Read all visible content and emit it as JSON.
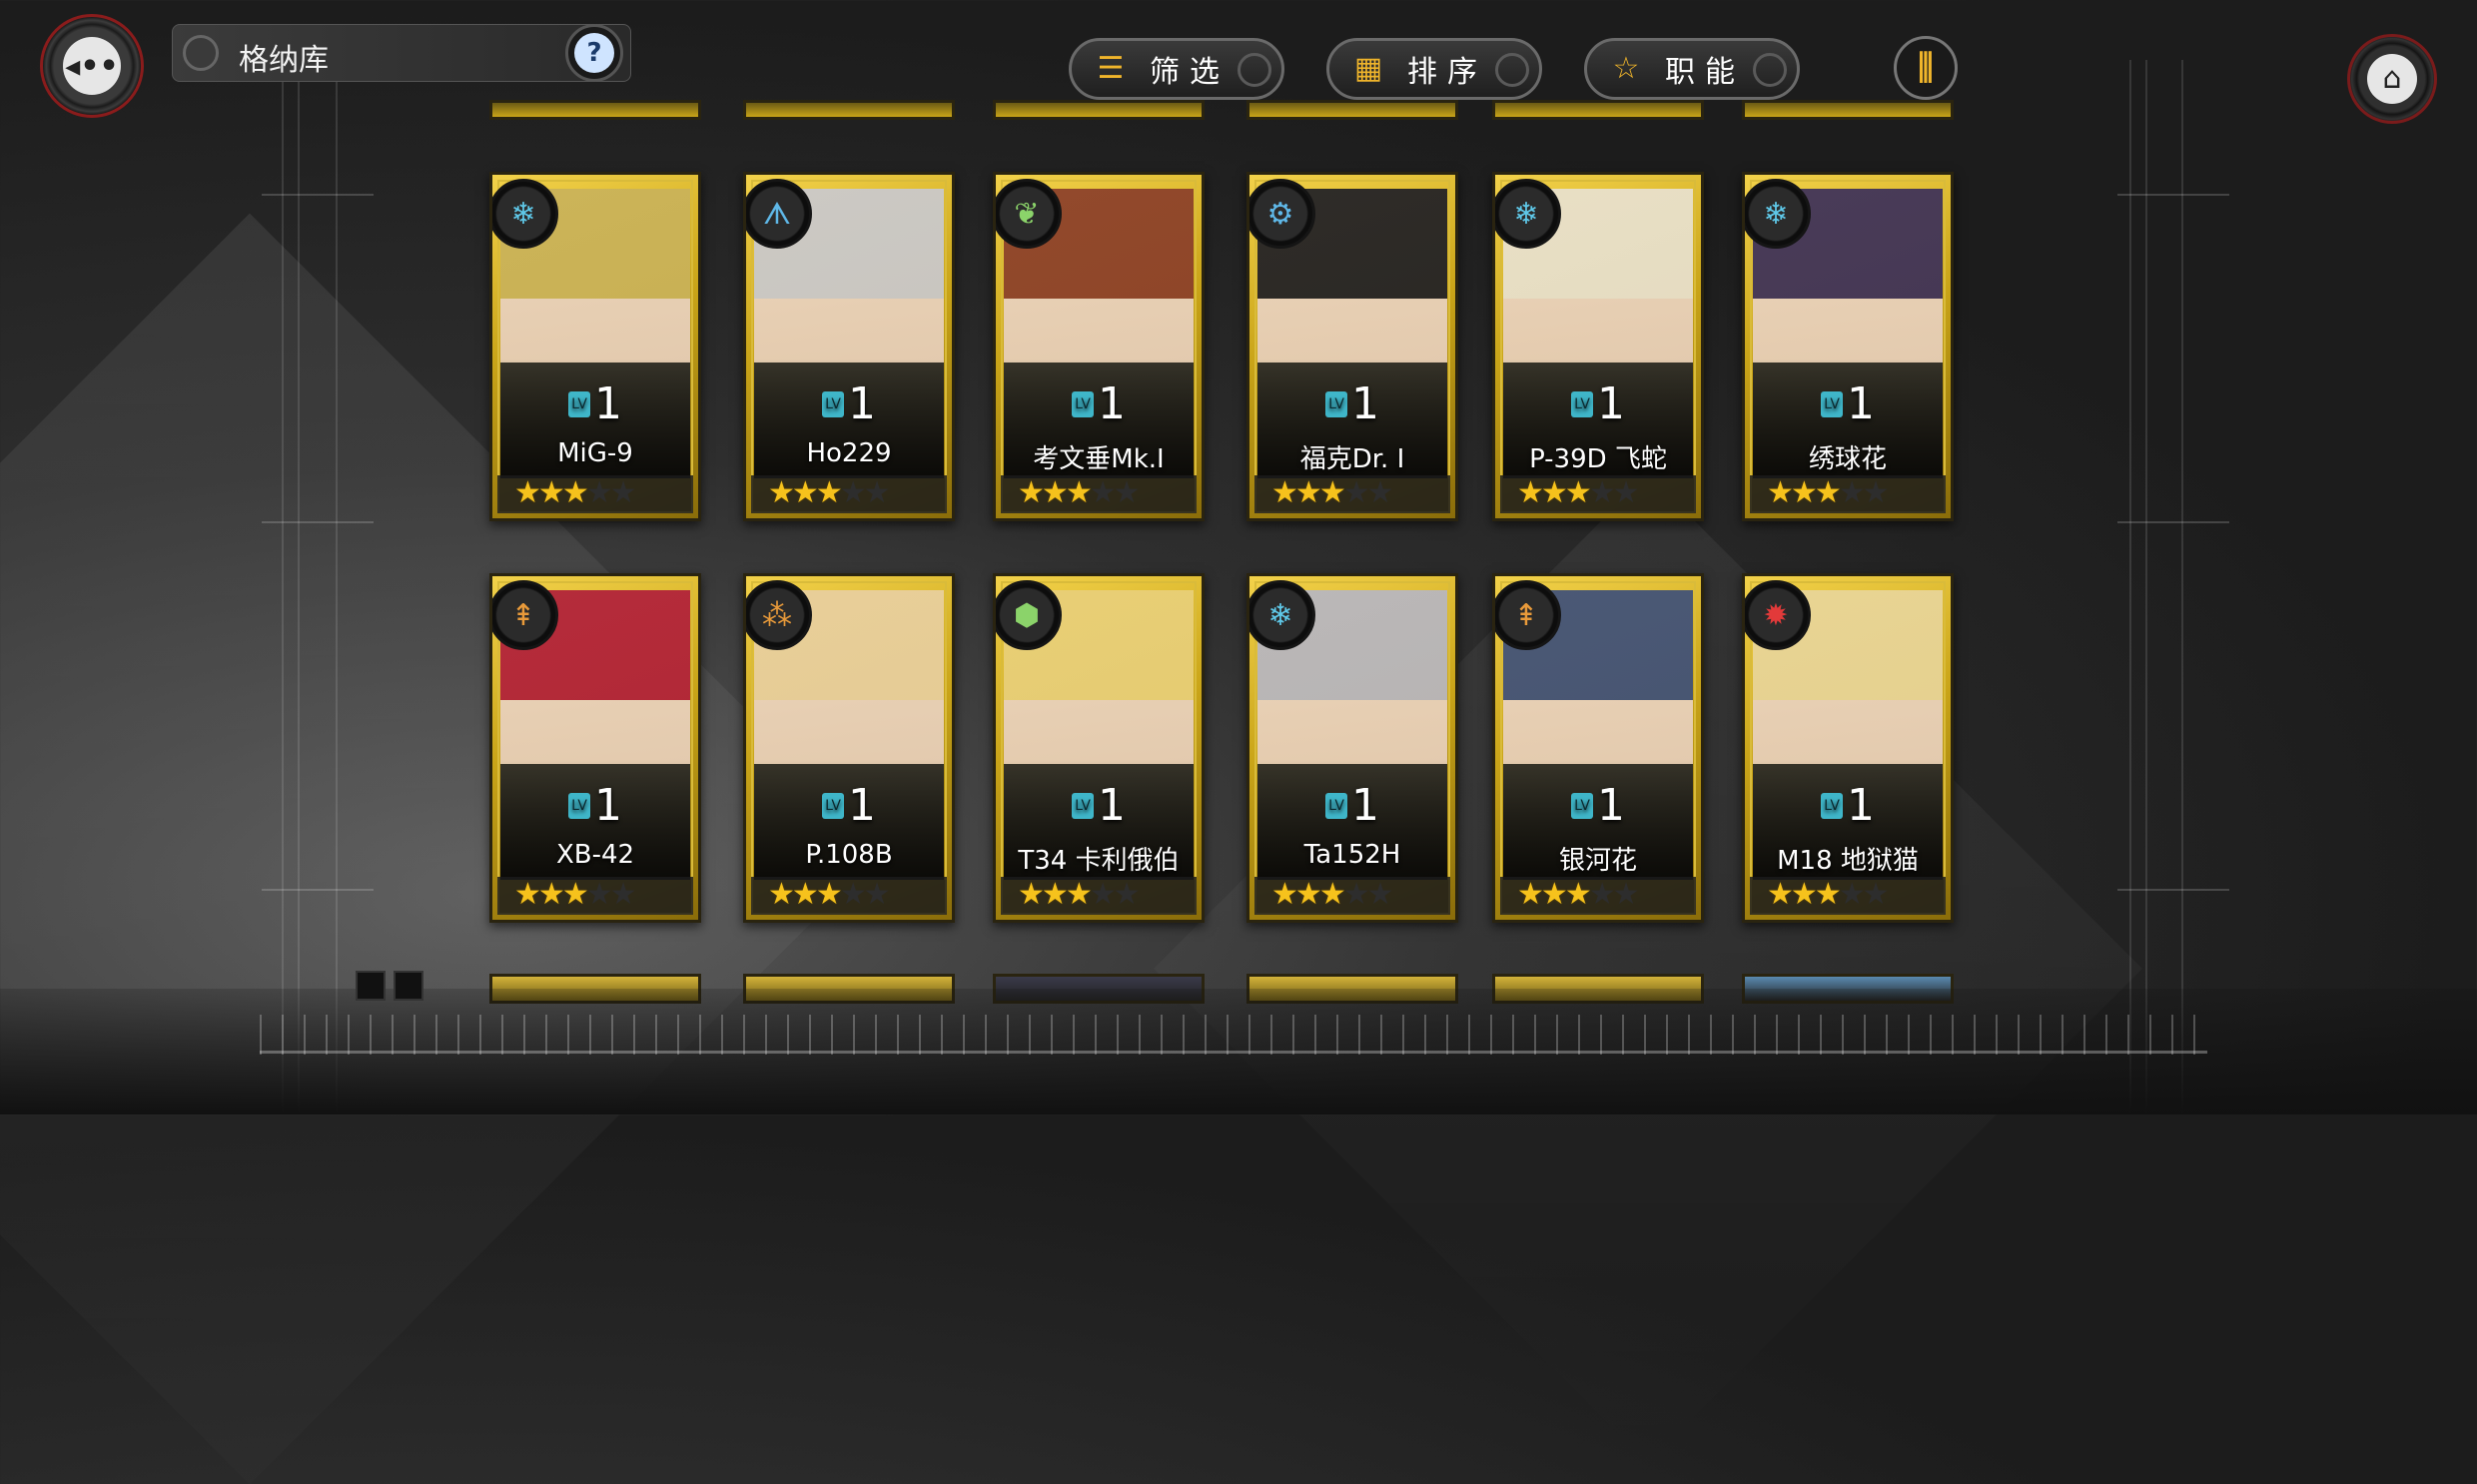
{
  "header": {
    "title": "格纳库",
    "filter_label": "筛选",
    "sort_label": "排序",
    "role_label": "职能"
  },
  "colors": {
    "accent": "#f0b52b",
    "card_gold": "#d4b12a",
    "star_on": "#f6c21c",
    "close_ring": "#8a1c1c"
  },
  "cards": [
    {
      "name": "MiG-9",
      "level": "1",
      "stars": 3,
      "role_icon": "snowflake-icon",
      "role_color": "#5fc8e8",
      "hair": "#c9b25a"
    },
    {
      "name": "Ho229",
      "level": "1",
      "stars": 3,
      "role_icon": "wing-icon",
      "role_color": "#5fb8e8",
      "hair": "#c9c9cf"
    },
    {
      "name": "考文垂Mk.I",
      "level": "1",
      "stars": 3,
      "role_icon": "leaf-icon",
      "role_color": "#8bd36a",
      "hair": "#8a3e2a"
    },
    {
      "name": "福克Dr. I",
      "level": "1",
      "stars": 3,
      "role_icon": "gear-ring-icon",
      "role_color": "#5fb8e8",
      "hair": "#1e1e26"
    },
    {
      "name": "P-39D 飞蛇",
      "level": "1",
      "stars": 3,
      "role_icon": "snowflake-icon",
      "role_color": "#5fc8e8",
      "hair": "#e8e1d0"
    },
    {
      "name": "绣球花",
      "level": "1",
      "stars": 3,
      "role_icon": "snowflake-icon",
      "role_color": "#5fc8e8",
      "hair": "#3b2f5a"
    },
    {
      "name": "XB-42",
      "level": "1",
      "stars": 3,
      "role_icon": "missile-icon",
      "role_color": "#e89a3a",
      "hair": "#b01e3a"
    },
    {
      "name": "P.108B",
      "level": "1",
      "stars": 3,
      "role_icon": "cluster-icon",
      "role_color": "#e89a3a",
      "hair": "#e8cfa0"
    },
    {
      "name": "T34 卡利俄伯",
      "level": "1",
      "stars": 3,
      "role_icon": "hex-leaf-icon",
      "role_color": "#8bd36a",
      "hair": "#e8cf7a"
    },
    {
      "name": "Ta152H",
      "level": "1",
      "stars": 3,
      "role_icon": "snowflake-icon",
      "role_color": "#5fc8e8",
      "hair": "#b6b6c2"
    },
    {
      "name": "银河花",
      "level": "1",
      "stars": 3,
      "role_icon": "missile-icon",
      "role_color": "#e89a3a",
      "hair": "#3d4f7a"
    },
    {
      "name": "M18 地狱猫",
      "level": "1",
      "stars": 3,
      "role_icon": "cog-red-icon",
      "role_color": "#e23a3a",
      "hair": "#e8d59a"
    }
  ],
  "card_labels": {
    "lv_tag": "LV"
  }
}
